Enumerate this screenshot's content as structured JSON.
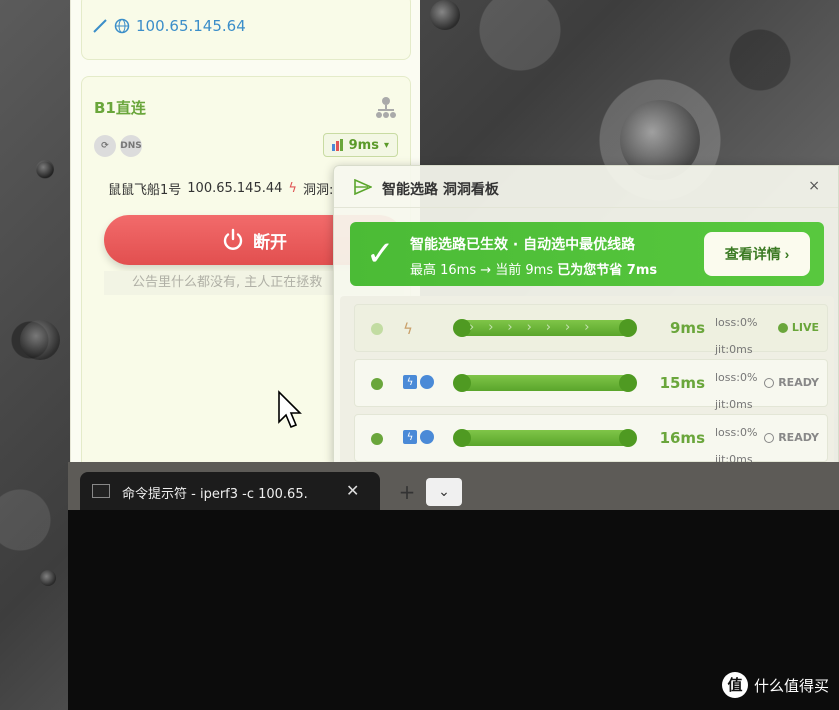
{
  "app": {
    "top_card": {
      "ip": "100.65.145.64"
    },
    "route_card": {
      "title": "B1直连",
      "latency": "9ms",
      "node_name": "鼠鼠飞船1号",
      "node_ip": "100.65.145.44",
      "node_mode": "洞洞:",
      "dns_label": "DNS",
      "disconnect_label": "断开",
      "notice": "公告里什么都没有, 主人正在拯救"
    }
  },
  "smart_panel": {
    "title": "智能选路 洞洞看板",
    "close": "×",
    "banner": {
      "check": "✓",
      "title": "智能选路已生效 · 自动选中最优线路",
      "sub_prefix": "最高 16ms → 当前 9ms",
      "sub_highlight": "已为您节省 7ms",
      "details_label": "查看详情 ›"
    },
    "routes": [
      {
        "ms": "9ms",
        "loss": "loss:0%",
        "jit": "jit:0ms",
        "status": "LIVE"
      },
      {
        "ms": "15ms",
        "loss": "loss:0%",
        "jit": "jit:0ms",
        "status": "READY"
      },
      {
        "ms": "16ms",
        "loss": "loss:0%",
        "jit": "jit:0ms",
        "status": "READY"
      }
    ]
  },
  "terminal": {
    "tab_title": "命令提示符 - iperf3  -c 100.65.",
    "close": "✕",
    "new_tab": "+",
    "dropdown": "⌄"
  },
  "watermark": {
    "logo": "值",
    "text": "什么值得买"
  }
}
